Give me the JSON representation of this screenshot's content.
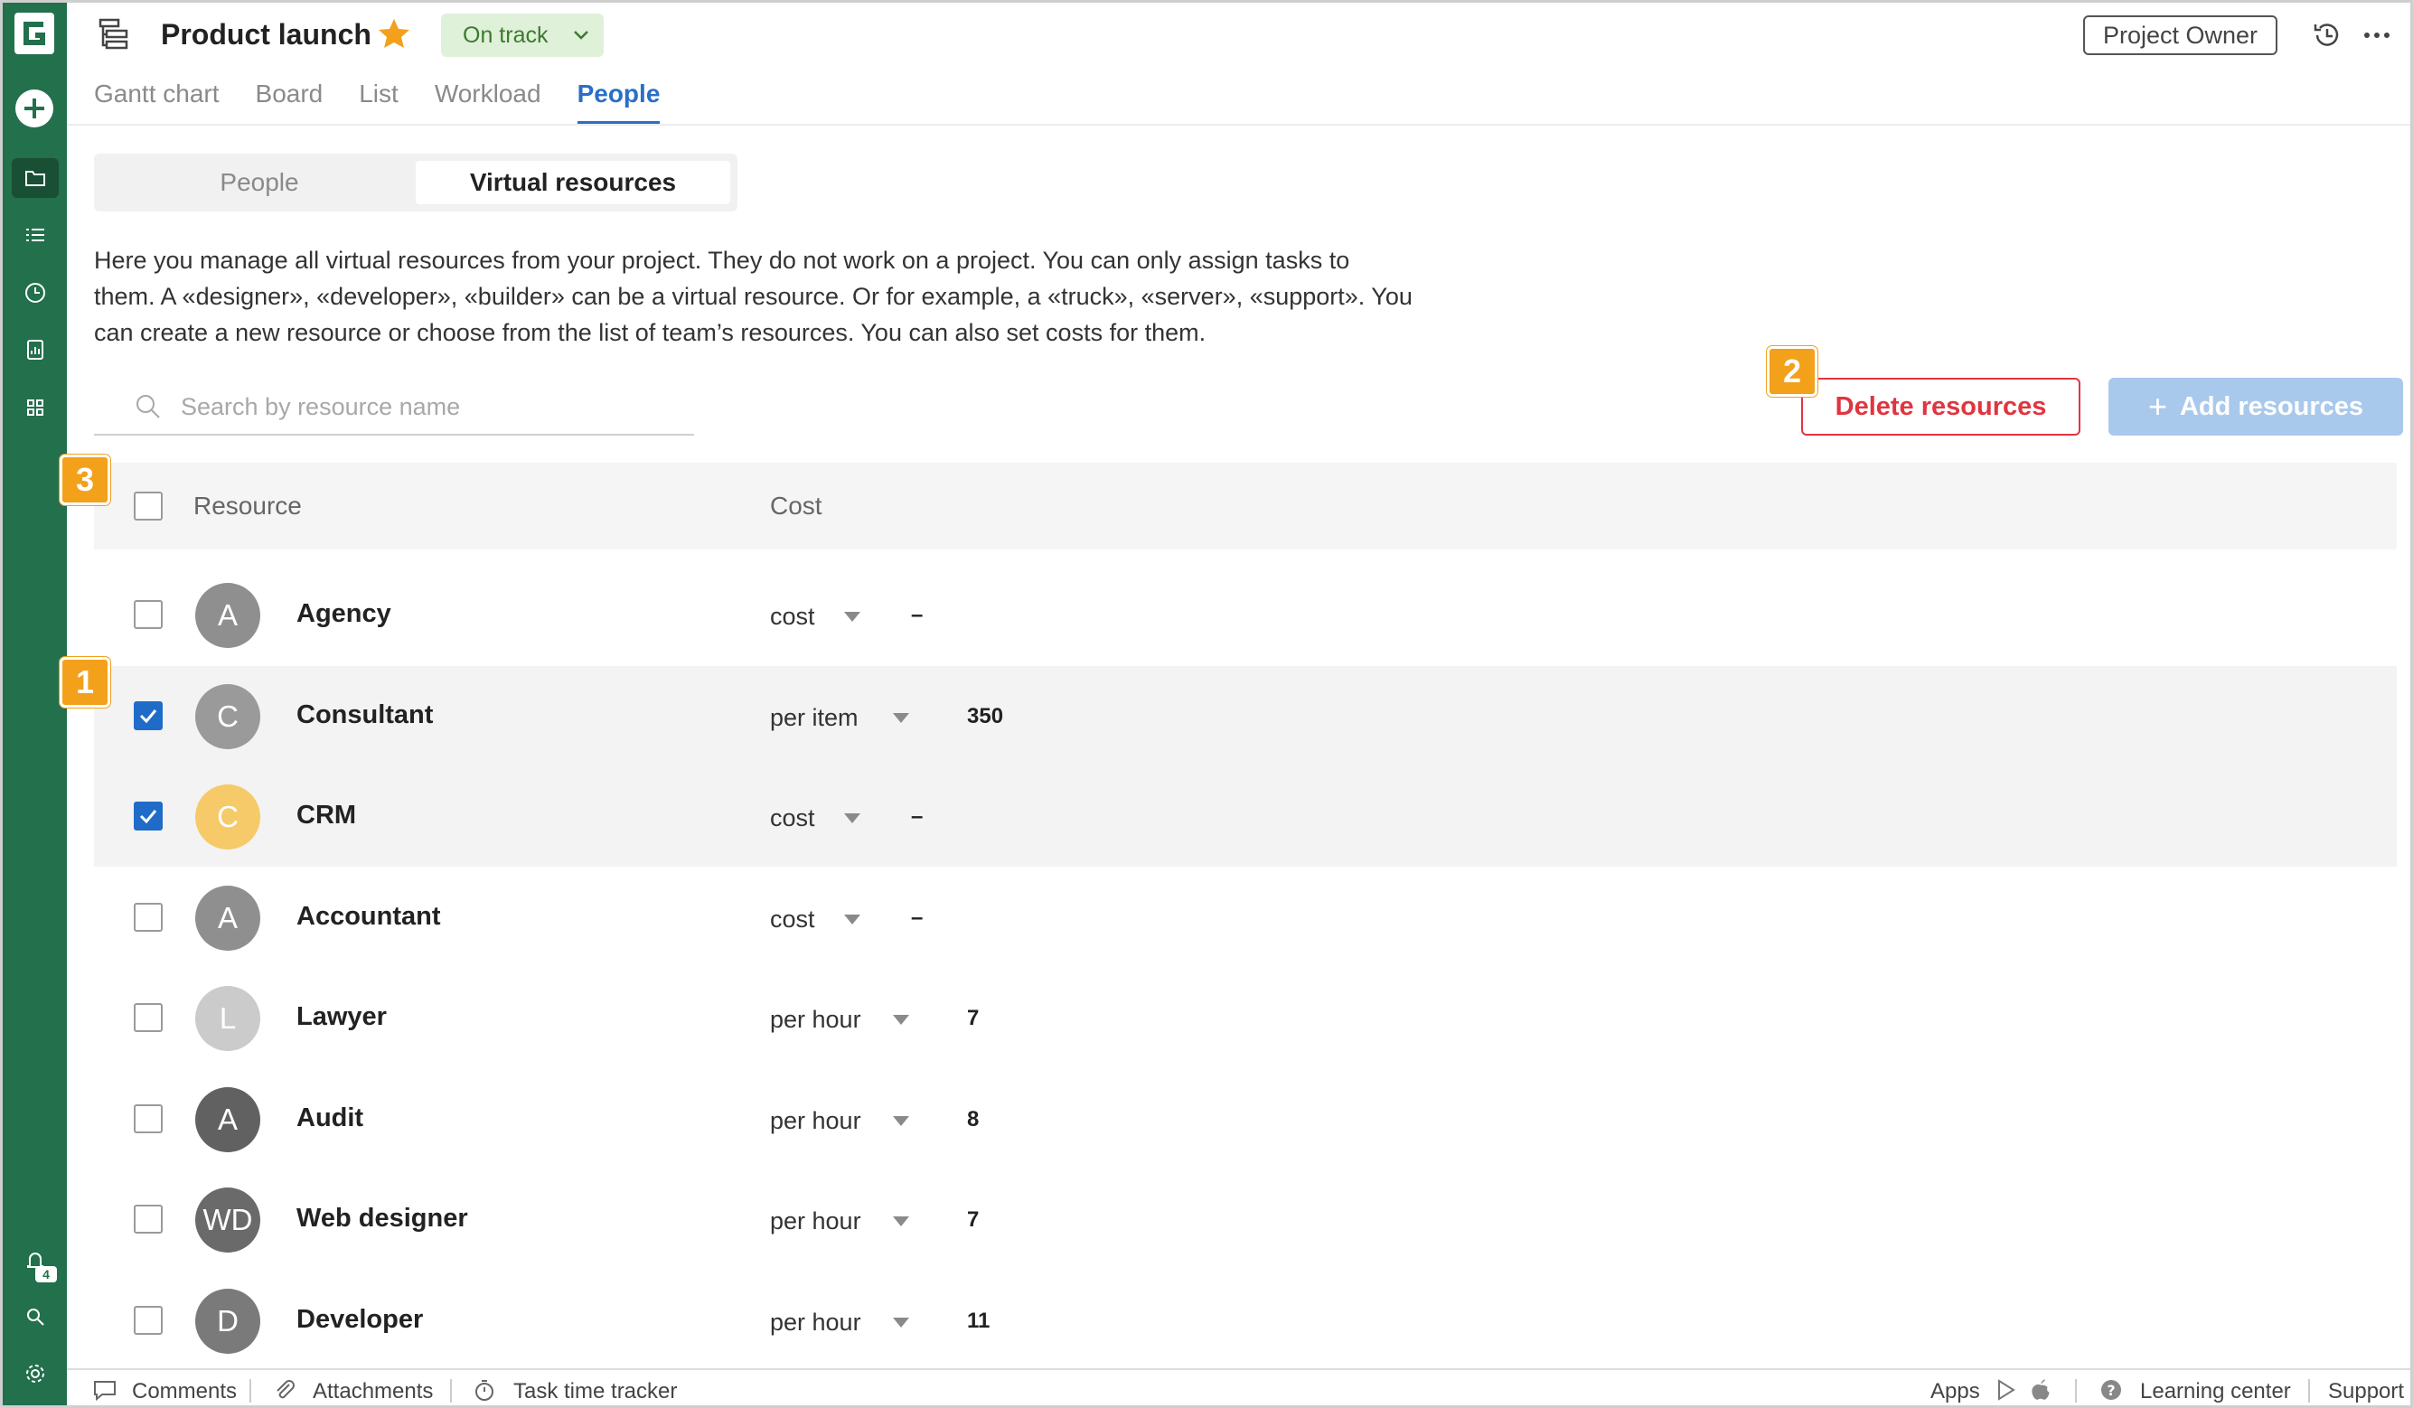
{
  "header": {
    "title": "Product launch",
    "status": "On track",
    "owner_label": "Project Owner"
  },
  "view_tabs": [
    {
      "label": "Gantt chart",
      "active": false
    },
    {
      "label": "Board",
      "active": false
    },
    {
      "label": "List",
      "active": false
    },
    {
      "label": "Workload",
      "active": false
    },
    {
      "label": "People",
      "active": true
    }
  ],
  "segment": {
    "people": "People",
    "virtual_resources": "Virtual resources"
  },
  "description": "Here you manage all virtual resources from your project. They do not work on a project. You can only assign tasks to them. A «designer», «developer», «builder» can be a virtual resource. Or for example, a «truck», «server», «support». You can create a new resource or choose from the list of team’s resources. You can also set costs for them.",
  "search": {
    "placeholder": "Search by resource name",
    "value": ""
  },
  "buttons": {
    "delete": "Delete resources",
    "add": "Add resources",
    "add_icon": "+"
  },
  "markers": [
    "1",
    "2",
    "3"
  ],
  "sidebar": {
    "notification_count": "4"
  },
  "table": {
    "headers": {
      "resource": "Resource",
      "cost": "Cost"
    },
    "rows": [
      {
        "initials": "A",
        "name": "Agency",
        "cost_type": "cost",
        "value": "–",
        "checked": false,
        "avatar_color": "#8f8f8f"
      },
      {
        "initials": "C",
        "name": "Consultant",
        "cost_type": "per item",
        "value": "350",
        "checked": true,
        "avatar_color": "#9a9a9a"
      },
      {
        "initials": "C",
        "name": "CRM",
        "cost_type": "cost",
        "value": "–",
        "checked": true,
        "avatar_color": "#f6ca68"
      },
      {
        "initials": "A",
        "name": "Accountant",
        "cost_type": "cost",
        "value": "–",
        "checked": false,
        "avatar_color": "#8f8f8f"
      },
      {
        "initials": "L",
        "name": "Lawyer",
        "cost_type": "per hour",
        "value": "7",
        "checked": false,
        "avatar_color": "#cbcbcb"
      },
      {
        "initials": "A",
        "name": "Audit",
        "cost_type": "per hour",
        "value": "8",
        "checked": false,
        "avatar_color": "#616161"
      },
      {
        "initials": "WD",
        "name": "Web designer",
        "cost_type": "per hour",
        "value": "7",
        "checked": false,
        "avatar_color": "#6a6a6a"
      },
      {
        "initials": "D",
        "name": "Developer",
        "cost_type": "per hour",
        "value": "11",
        "checked": false,
        "avatar_color": "#7a7a7a"
      }
    ]
  },
  "footer": {
    "comments": "Comments",
    "attachments": "Attachments",
    "time_tracker": "Task time tracker",
    "apps": "Apps",
    "learning": "Learning center",
    "support": "Support"
  },
  "colors": {
    "sidebar": "#22704c",
    "accent": "#2a6fc7",
    "danger": "#e0353f",
    "marker": "#f3a01b"
  }
}
